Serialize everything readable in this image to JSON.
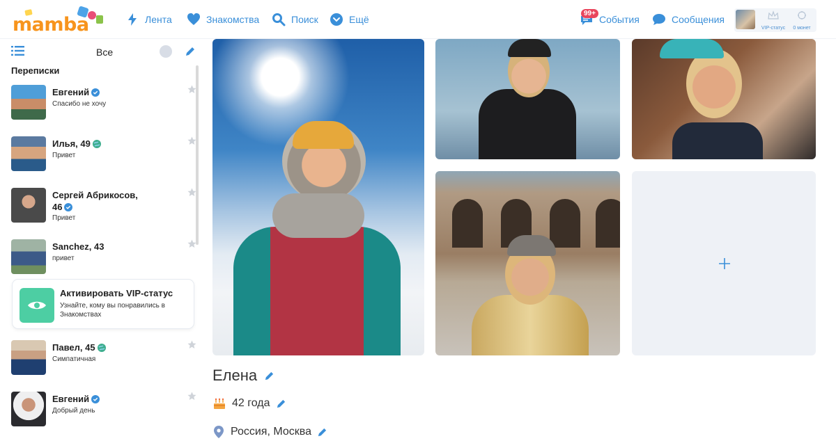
{
  "header": {
    "logo": "mamba",
    "nav": [
      {
        "label": "Лента",
        "icon": "bolt-icon"
      },
      {
        "label": "Знакомства",
        "icon": "heart-icon"
      },
      {
        "label": "Поиск",
        "icon": "search-icon"
      },
      {
        "label": "Ещё",
        "icon": "chevron-down-icon"
      }
    ],
    "events": {
      "label": "События",
      "badge": "99+",
      "icon": "events-icon"
    },
    "messages": {
      "label": "Сообщения",
      "icon": "chat-bubble-icon"
    },
    "user_box": {
      "vip_label": "VIP-статус",
      "coins_label": "0 монет"
    }
  },
  "sidebar": {
    "filter_label": "Все",
    "section_title": "Переписки",
    "chats": [
      {
        "name": "Евгений",
        "verified": true,
        "message": "Спасибо не хочу"
      },
      {
        "name": "Илья, 49",
        "online_globe": true,
        "message": "Привет"
      },
      {
        "name": "Сергей Абрикосов, 46",
        "verified": true,
        "message": "Привет"
      },
      {
        "name": "Sanchez, 43",
        "message": "привет"
      },
      {
        "name": "Павел, 45",
        "online_globe": true,
        "message": "Симпатичная"
      },
      {
        "name": "Евгений",
        "verified": true,
        "message": "Добрый день"
      }
    ],
    "vip": {
      "title": "Активировать VIP-статус",
      "description": "Узнайте, кому вы понравились в Знакомствах"
    }
  },
  "profile": {
    "name": "Елена",
    "age": "42 года",
    "location": "Россия, Москва"
  },
  "colors": {
    "accent": "#3a8fd9",
    "badge": "#e9465d",
    "vip": "#4dcea3",
    "logo": "#f7941d"
  }
}
